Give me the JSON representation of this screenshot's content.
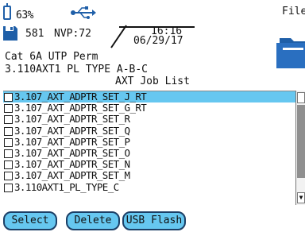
{
  "header": {
    "battery_text": "63%",
    "file_label": "File",
    "record_count": "581",
    "nvp": "NVP:72",
    "time": "16:16",
    "date": "06/29/17"
  },
  "cable_type": "Cat 6A UTP Perm",
  "test_limit": "3.110AXT1 PL TYPE A-B-C",
  "list": {
    "title": "AXT Job List",
    "items": [
      "3.107_AXT_ADPTR_SET_J_RT",
      "3.107_AXT_ADPTR_SET_G_RT",
      "3.107_AXT_ADPTR_SET_R",
      "3.107_AXT_ADPTR_SET_Q",
      "3.107_AXT_ADPTR_SET_P",
      "3.107_AXT_ADPTR_SET_O",
      "3.107_AXT_ADPTR_SET_N",
      "3.107_AXT_ADPTR_SET_M",
      "3.110AXT1_PL_TYPE_C"
    ],
    "selected_index": 0
  },
  "softkeys": {
    "select": "Select",
    "delete": "Delete",
    "usb_flash": "USB Flash"
  },
  "colors": {
    "highlight": "#66c7f0",
    "icon_blue": "#1f5fa8"
  }
}
